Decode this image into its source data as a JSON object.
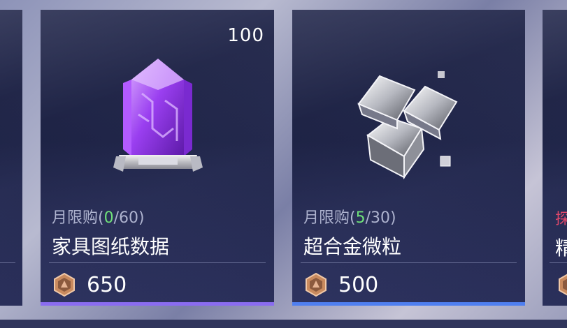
{
  "shop": {
    "items": [
      {
        "quantity": "100",
        "limit_prefix": "月限购(",
        "limit_current": "0",
        "limit_sep": "/",
        "limit_max": "60",
        "limit_suffix": ")",
        "name": "家具图纸数据",
        "price": "650",
        "icon": "purple-crystal-blueprint-icon",
        "accent_color": "#8a6cf0"
      },
      {
        "quantity": "",
        "limit_prefix": "月限购(",
        "limit_current": "5",
        "limit_sep": "/",
        "limit_max": "30",
        "limit_suffix": ")",
        "name": "超合金微粒",
        "price": "500",
        "icon": "metal-cubes-icon",
        "accent_color": "#4f7ff0"
      }
    ],
    "partial_right": {
      "tag": "探",
      "name": "精"
    },
    "currency_icon": "bronze-hex-coin-icon",
    "limit_highlight_color": "#6fe07a"
  }
}
